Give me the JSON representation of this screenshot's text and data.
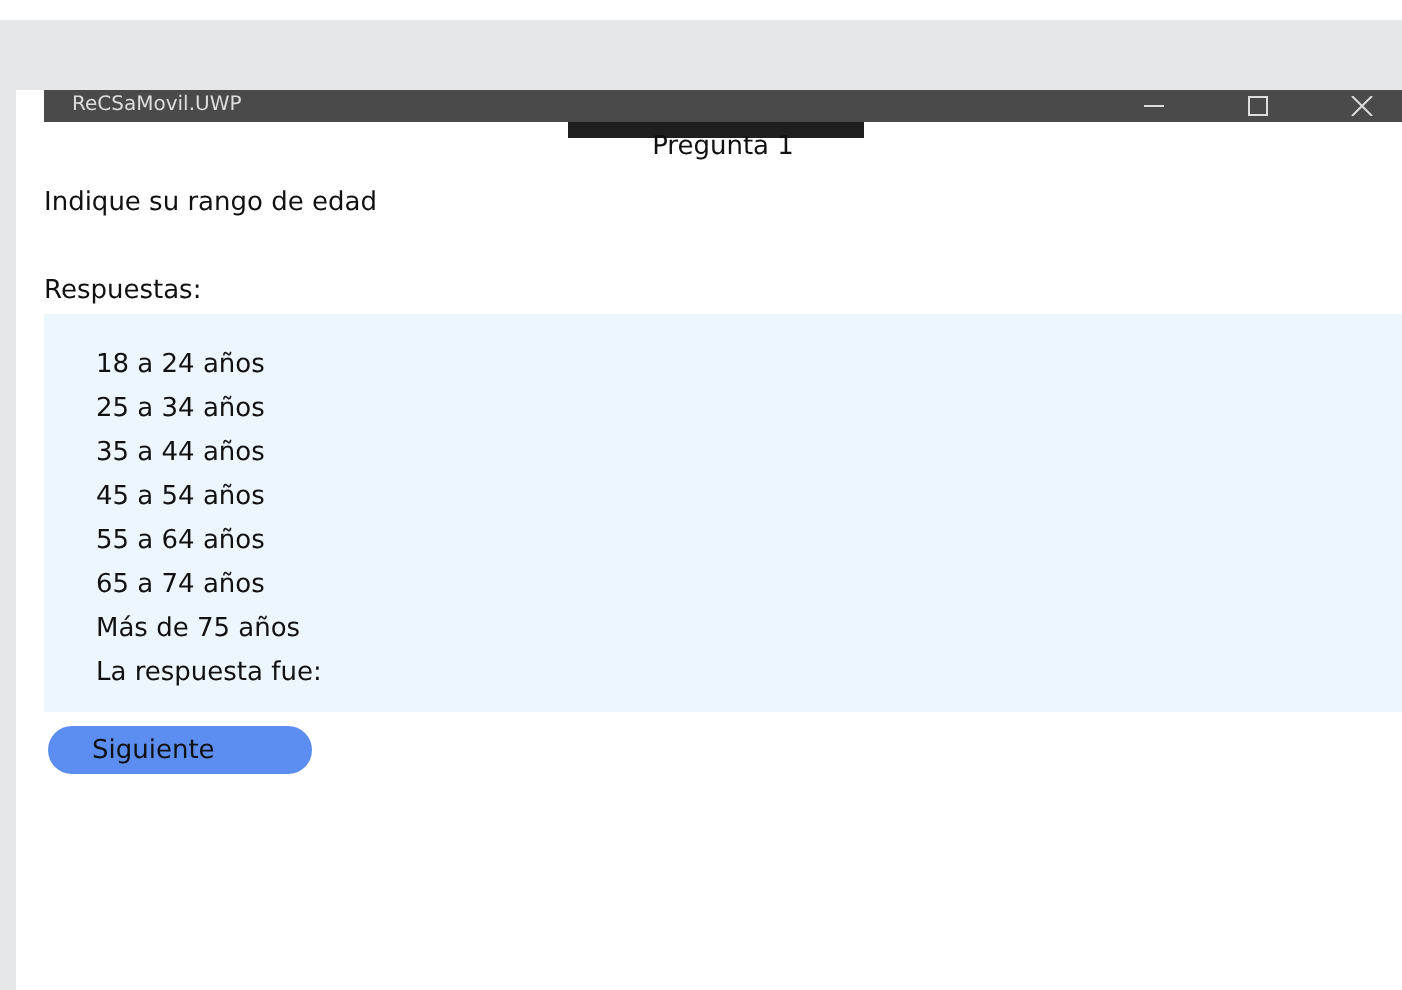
{
  "window": {
    "title": "ReCSaMovil.UWP"
  },
  "page": {
    "heading": "Pregunta 1",
    "question": "Indique su rango de edad",
    "answers_label": "Respuestas:"
  },
  "answers": [
    "18 a 24 años",
    "25 a 34 años",
    "35 a 44 años",
    "45 a 54 años",
    "55 a 64 años",
    "65 a 74 años",
    "Más de 75 años"
  ],
  "result_label": "La respuesta fue:",
  "buttons": [
    "Siguiente"
  ]
}
